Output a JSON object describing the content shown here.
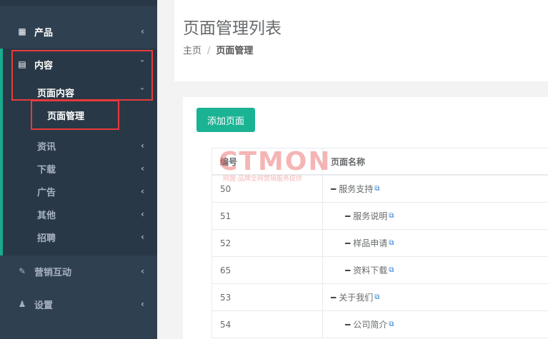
{
  "sidebar": {
    "products": {
      "label": "产品",
      "icon": "grid-icon"
    },
    "content": {
      "label": "内容",
      "icon": "document-icon",
      "children": {
        "page_content": {
          "label": "页面内容"
        },
        "page_manage": {
          "label": "页面管理"
        },
        "news": {
          "label": "资讯"
        },
        "download": {
          "label": "下载"
        },
        "ads": {
          "label": "广告"
        },
        "other": {
          "label": "其他"
        },
        "jobs": {
          "label": "招聘"
        }
      }
    },
    "marketing": {
      "label": "营销互动",
      "icon": "edit-icon"
    },
    "settings": {
      "label": "设置",
      "icon": "user-plus-icon"
    }
  },
  "page": {
    "title": "页面管理列表",
    "breadcrumb": {
      "home": "主页",
      "sep": "/",
      "current": "页面管理"
    }
  },
  "toolbar": {
    "add_label": "添加页面"
  },
  "table": {
    "headers": {
      "id": "编号",
      "name": "页面名称"
    },
    "rows": [
      {
        "id": "50",
        "name": "服务支持",
        "indent": false
      },
      {
        "id": "51",
        "name": "服务说明",
        "indent": true
      },
      {
        "id": "52",
        "name": "样品申请",
        "indent": true
      },
      {
        "id": "65",
        "name": "资料下载",
        "indent": true
      },
      {
        "id": "53",
        "name": "关于我们",
        "indent": false
      },
      {
        "id": "54",
        "name": "公司简介",
        "indent": true
      }
    ]
  },
  "watermark": {
    "logo": "CTMON",
    "tagline": "网盟·品牌全网营销服务提供"
  },
  "colors": {
    "sidebar": "#2f4050",
    "accent": "#1ab394",
    "highlight_box": "#e83b3b",
    "link_icon": "#2e7bd6"
  }
}
